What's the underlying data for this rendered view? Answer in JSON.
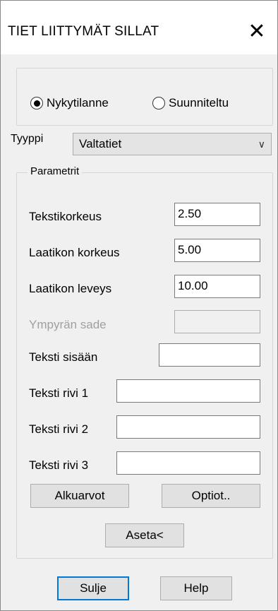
{
  "window": {
    "title": "TIET  LIITTYMÄT  SILLAT",
    "close_glyph": "✕"
  },
  "mode": {
    "option1": "Nykytilanne",
    "option2": "Suunniteltu",
    "selected": "Nykytilanne"
  },
  "type": {
    "label": "Tyyppi",
    "value": "Valtatiet",
    "chevron": "∨"
  },
  "parameters": {
    "legend": "Parametrit",
    "text_height": {
      "label": "Tekstikorkeus",
      "value": "2.50"
    },
    "box_height": {
      "label": "Laatikon korkeus",
      "value": "5.00"
    },
    "box_width": {
      "label": "Laatikon leveys",
      "value": "10.00"
    },
    "circle_radius": {
      "label": "Ympyrän sade",
      "value": ""
    },
    "text_inside": {
      "label": "Teksti sisään",
      "value": ""
    },
    "text_row1": {
      "label": "Teksti rivi 1",
      "value": ""
    },
    "text_row2": {
      "label": "Teksti rivi 2",
      "value": ""
    },
    "text_row3": {
      "label": "Teksti rivi 3",
      "value": ""
    },
    "defaults_button": "Alkuarvot",
    "options_button": "Optiot..",
    "set_button": "Aseta<"
  },
  "footer": {
    "close_button": "Sulje",
    "help_button": "Help"
  }
}
